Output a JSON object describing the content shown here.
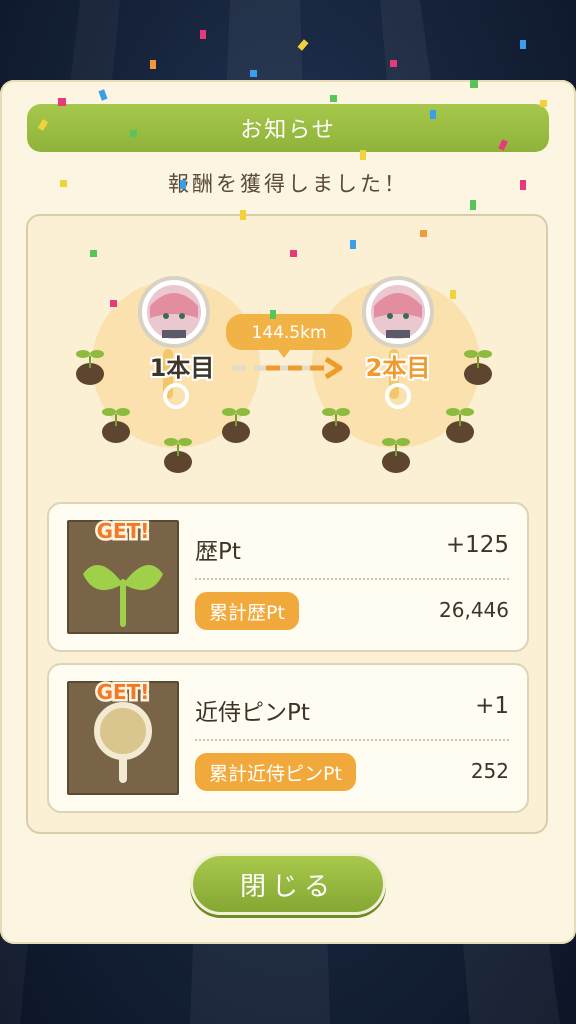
{
  "header": {
    "title": "お知らせ"
  },
  "message": "報酬を獲得しました！",
  "route": {
    "distance": "144.5km",
    "from_label": "1本目",
    "to_label": "2本目"
  },
  "rewards": [
    {
      "name": "歴Pt",
      "value": "+125",
      "total_label": "累計歴Pt",
      "total_value": "26,446",
      "badge": "GET!",
      "icon": "sprout-icon"
    },
    {
      "name": "近侍ピンPt",
      "value": "+1",
      "total_label": "累計近侍ピンPt",
      "total_value": "252",
      "badge": "GET!",
      "icon": "magnifier-pin-icon"
    }
  ],
  "close_button": {
    "label": "閉じる"
  },
  "colors": {
    "accent_green": "#9cbf44",
    "accent_orange": "#f2a93b",
    "panel": "#fbf5e2"
  }
}
